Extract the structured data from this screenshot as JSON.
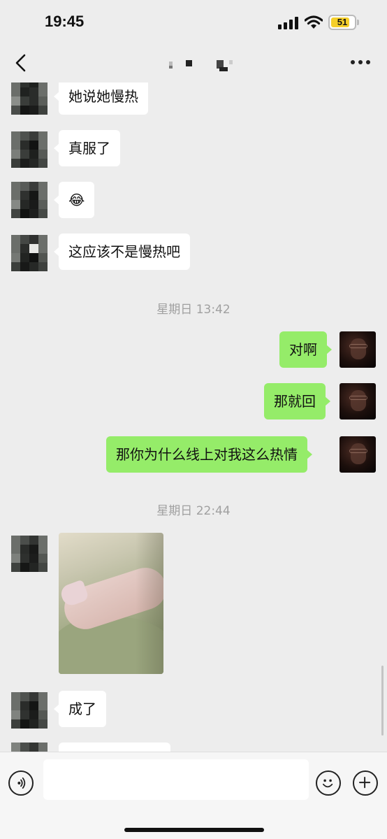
{
  "status_bar": {
    "time": "19:45",
    "battery": "51"
  },
  "nav": {
    "title_obscured": true
  },
  "colors": {
    "self_bubble": "#95ec69",
    "other_bubble": "#ffffff",
    "background": "#ededed",
    "battery_fill": "#f5cf2a"
  },
  "messages": [
    {
      "sender": "other",
      "text": "她说她慢热"
    },
    {
      "sender": "other",
      "text": "真服了"
    },
    {
      "sender": "other",
      "text": "😂"
    },
    {
      "sender": "other",
      "text": "这应该不是慢热吧"
    },
    {
      "type": "timestamp",
      "text": "星期日 13:42"
    },
    {
      "sender": "self",
      "text": "对啊"
    },
    {
      "sender": "self",
      "text": "那就回"
    },
    {
      "sender": "self",
      "text": "那你为什么线上对我这么热情"
    },
    {
      "type": "timestamp",
      "text": "星期日 22:44"
    },
    {
      "sender": "other",
      "type": "image"
    },
    {
      "sender": "other",
      "text": "成了"
    },
    {
      "sender": "other",
      "text": ""
    }
  ],
  "input": {
    "value": "",
    "placeholder": ""
  },
  "icons": {
    "back": "chevron-left-icon",
    "more": "more-icon",
    "voice": "voice-icon",
    "emoji": "emoji-icon",
    "add": "plus-icon"
  }
}
